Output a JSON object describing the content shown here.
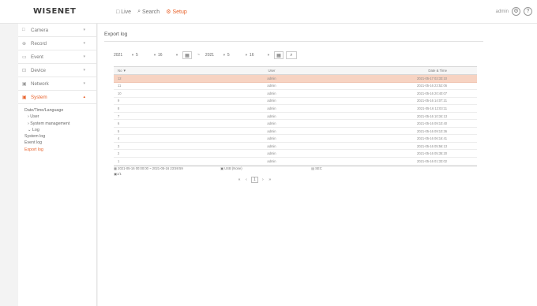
{
  "header": {
    "logo": "WISENET",
    "nav": [
      {
        "label": "Live",
        "icon": "□"
      },
      {
        "label": "Search",
        "icon": "⌕"
      },
      {
        "label": "Setup",
        "icon": "⚙"
      }
    ],
    "user": "admin",
    "accent": "#e8622b"
  },
  "sidebar": {
    "menus": [
      {
        "label": "Camera",
        "icon": "□"
      },
      {
        "label": "Record",
        "icon": "⊕"
      },
      {
        "label": "Event",
        "icon": "▭"
      },
      {
        "label": "Device",
        "icon": "⊡"
      },
      {
        "label": "Network",
        "icon": "▣"
      },
      {
        "label": "System",
        "icon": "▣"
      }
    ],
    "system_sub": [
      "Date/Time/Language",
      "User",
      "System management",
      "Log",
      "System log",
      "Event log",
      "Export log"
    ]
  },
  "main": {
    "title": "Export log",
    "filters": {
      "from": {
        "year": "2021",
        "month": "5",
        "day": "16"
      },
      "to": {
        "year": "2021",
        "month": "5",
        "day": "16"
      }
    },
    "table": {
      "headers": [
        "No ▼",
        "User",
        "Date & Time"
      ],
      "rows": [
        [
          "12",
          "admin",
          "2021-05-17 02:33:10"
        ],
        [
          "11",
          "admin",
          "2021-05-16 23:52:06"
        ],
        [
          "10",
          "admin",
          "2021-05-16 20:40:07"
        ],
        [
          "9",
          "admin",
          "2021-05-16 14:07:21"
        ],
        [
          "8",
          "admin",
          "2021-05-16 12:03:11"
        ],
        [
          "7",
          "admin",
          "2021-05-16 10:34:13"
        ],
        [
          "6",
          "admin",
          "2021-05-16 09:10:40"
        ],
        [
          "5",
          "admin",
          "2021-05-16 09:10:36"
        ],
        [
          "4",
          "admin",
          "2021-05-16 06:16:41"
        ],
        [
          "3",
          "admin",
          "2021-05-16 05:56:13"
        ],
        [
          "2",
          "admin",
          "2021-05-16 05:35:20"
        ],
        [
          "1",
          "admin",
          "2021-05-16 01:33:02"
        ]
      ]
    },
    "summary": {
      "range": "2021-05-16 00:00:00 ~ 2021-05-16 23:59:59",
      "user": "USB (None)",
      "count": "1/1",
      "format": "SEC"
    },
    "pager": {
      "first": "«",
      "prev": "‹",
      "current": "1",
      "next": "›",
      "last": "»"
    }
  }
}
